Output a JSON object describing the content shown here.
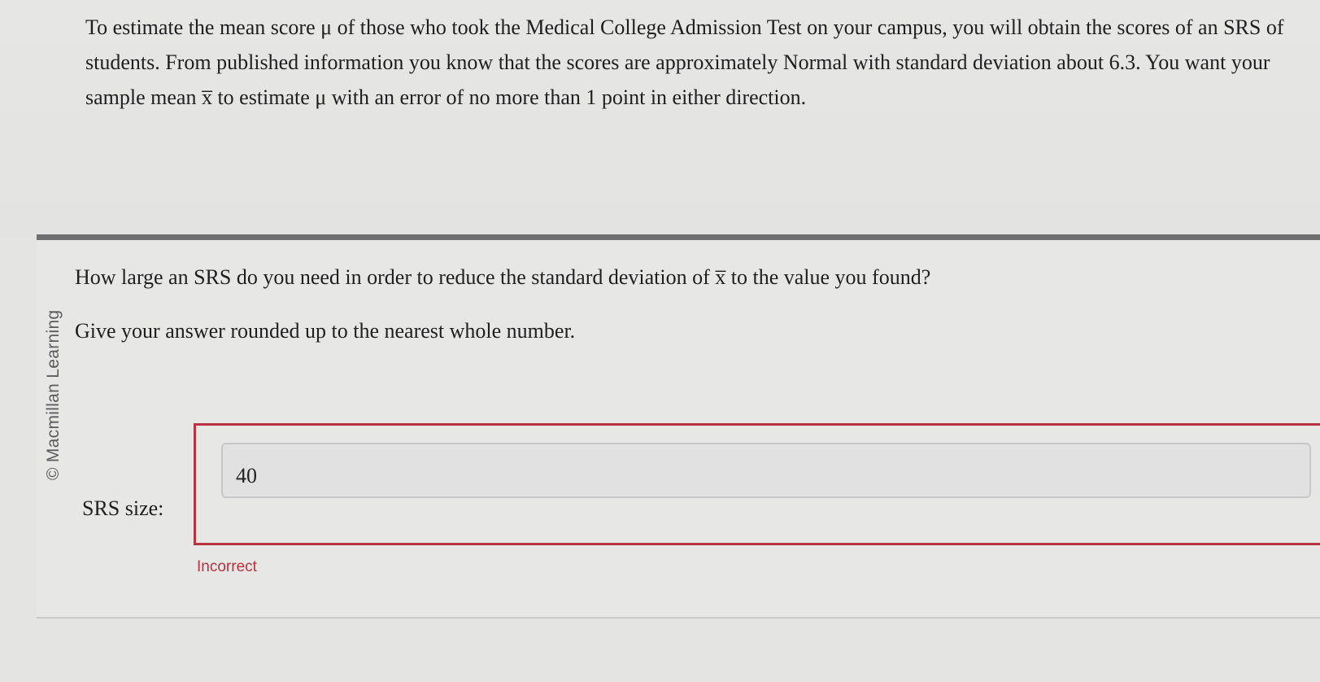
{
  "problem": {
    "intro_text": "To estimate the mean score μ of those who took the Medical College Admission Test on your campus, you will obtain the scores of an SRS of students. From published information you know that the scores are approximately Normal with standard deviation about 6.3. You want your sample mean x̅ to estimate μ with an error of no more than 1 point in either direction."
  },
  "watermark": "© Macmillan Learning",
  "question": {
    "prompt": "How large an SRS do you need in order to reduce the standard deviation of x̅ to the value you found?",
    "instruction": "Give your answer rounded up to the nearest whole number."
  },
  "answer": {
    "label": "SRS size:",
    "value": "40",
    "feedback": "Incorrect"
  },
  "colors": {
    "error": "#b8323f",
    "divider": "#6f6f72"
  }
}
